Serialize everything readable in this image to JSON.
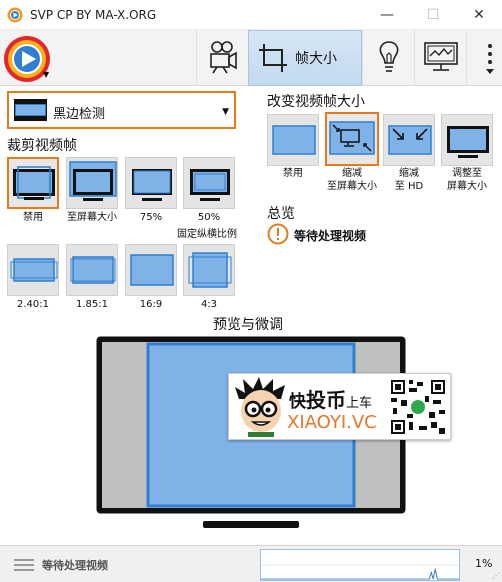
{
  "window": {
    "title": "SVP CP BY MA-X.ORG",
    "minimize": "—",
    "maximize": "☐",
    "close": "✕"
  },
  "toolbar": {
    "tabs": [
      {
        "name": "video-camera-icon"
      },
      {
        "name": "frame-resize-icon",
        "label": "帧大小",
        "active": true
      },
      {
        "name": "lightbulb-icon"
      },
      {
        "name": "monitor-chart-icon"
      }
    ]
  },
  "crop": {
    "dropdown_value": "黑边检测",
    "heading": "裁剪视频帧",
    "row1": [
      {
        "label": "禁用",
        "selected": true
      },
      {
        "label": "至屏幕大小"
      },
      {
        "label": "75%"
      },
      {
        "label": "50%"
      }
    ],
    "fixed_ratio_label": "固定纵横比例",
    "row2": [
      {
        "label": "2.40:1"
      },
      {
        "label": "1.85:1"
      },
      {
        "label": "16:9"
      },
      {
        "label": "4:3"
      }
    ]
  },
  "resize": {
    "heading": "改变视频帧大小",
    "options": [
      {
        "label": "禁用"
      },
      {
        "label": "缩减\n至屏幕大小",
        "selected": true
      },
      {
        "label": "缩减\n至 HD"
      },
      {
        "label": "调整至\n屏幕大小"
      }
    ]
  },
  "overview": {
    "heading": "总览",
    "status": "等待处理视频"
  },
  "preview": {
    "title": "预览与微调"
  },
  "watermark": {
    "line1_a": "快",
    "line1_b": "投币",
    "line1_c": "上车",
    "line2": "XIAOYI.VC"
  },
  "statusbar": {
    "text": "等待处理视频",
    "percent": "1%"
  },
  "colors": {
    "accent": "#e37a1c",
    "blue": "#2f7fd1",
    "light_blue": "#7fb3e8"
  }
}
